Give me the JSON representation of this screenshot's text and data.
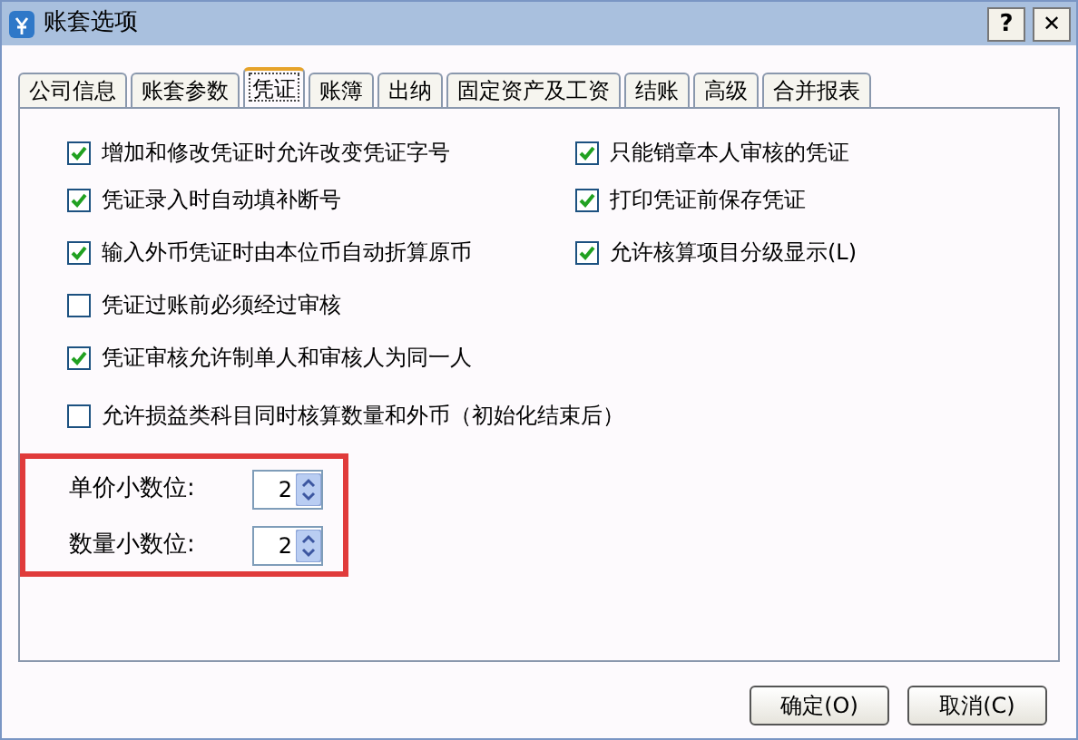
{
  "window": {
    "title": "账套选项",
    "help_button": "?",
    "close_button": "✕"
  },
  "tabs": [
    {
      "label": "公司信息",
      "selected": false
    },
    {
      "label": "账套参数",
      "selected": false
    },
    {
      "label": "凭证",
      "selected": true
    },
    {
      "label": "账簿",
      "selected": false
    },
    {
      "label": "出纳",
      "selected": false
    },
    {
      "label": "固定资产及工资",
      "selected": false
    },
    {
      "label": "结账",
      "selected": false
    },
    {
      "label": "高级",
      "selected": false
    },
    {
      "label": "合并报表",
      "selected": false
    }
  ],
  "options_left": [
    {
      "label": "增加和修改凭证时允许改变凭证字号",
      "checked": true
    },
    {
      "label": "凭证录入时自动填补断号",
      "checked": true
    },
    {
      "label": "输入外币凭证时由本位币自动折算原币",
      "checked": true
    },
    {
      "label": "凭证过账前必须经过审核",
      "checked": false
    },
    {
      "label": "凭证审核允许制单人和审核人为同一人",
      "checked": true
    },
    {
      "label": "允许损益类科目同时核算数量和外币（初始化结束后）",
      "checked": false
    }
  ],
  "options_right": [
    {
      "label": "只能销章本人审核的凭证",
      "checked": true
    },
    {
      "label": "打印凭证前保存凭证",
      "checked": true
    },
    {
      "label": "允许核算项目分级显示(L)",
      "checked": true
    }
  ],
  "spinners": [
    {
      "label": "单价小数位:",
      "value": "2"
    },
    {
      "label": "数量小数位:",
      "value": "2"
    }
  ],
  "buttons": [
    "确定(O)",
    "取消(C)"
  ]
}
